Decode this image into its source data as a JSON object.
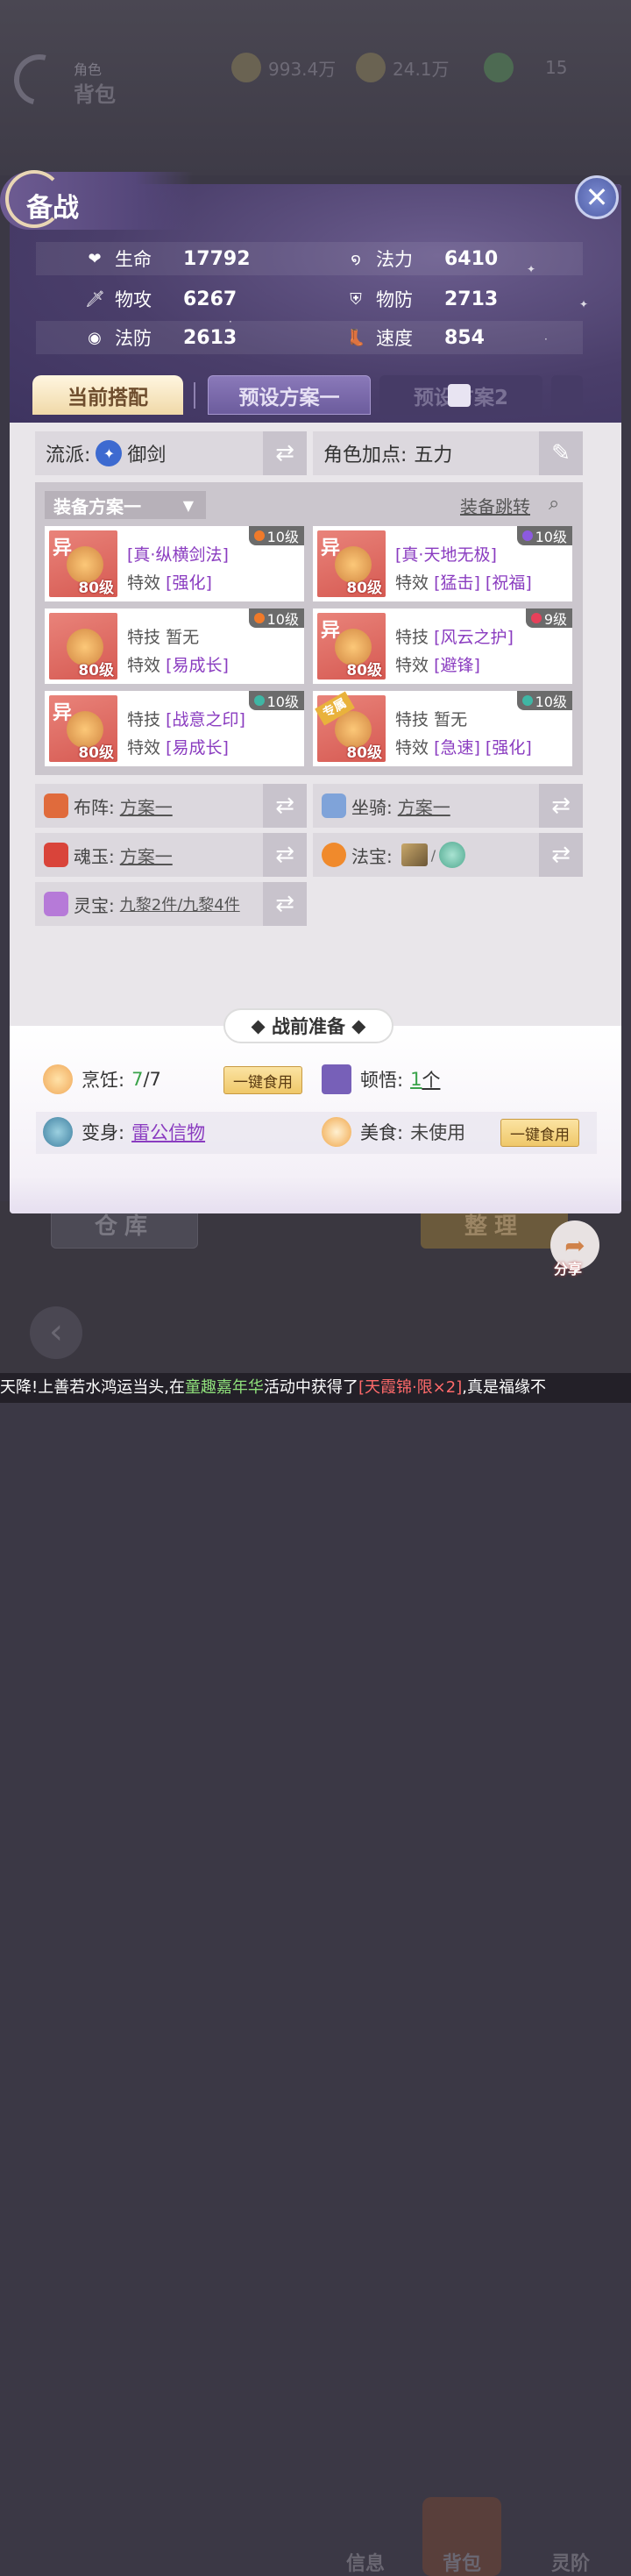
{
  "background": {
    "bag_subtitle": "角色",
    "bag_title": "背包",
    "currencies": [
      {
        "icon": "copper-coin-icon",
        "value": "993.4万"
      },
      {
        "icon": "gold-ingot-icon",
        "value": "24.1万"
      },
      {
        "icon": "jade-icon",
        "value": "15"
      }
    ],
    "warehouse_label": "仓库",
    "sort_label": "整理",
    "share_label": "分享",
    "nav": [
      "信息",
      "背包",
      "灵阶"
    ]
  },
  "panel": {
    "title": "备战",
    "stats": [
      {
        "icon": "heart-icon",
        "label": "生命",
        "value": "17792"
      },
      {
        "icon": "swirl-icon",
        "label": "法力",
        "value": "6410"
      },
      {
        "icon": "sword-icon",
        "label": "物攻",
        "value": "6267"
      },
      {
        "icon": "shield-icon",
        "label": "物防",
        "value": "2713"
      },
      {
        "icon": "magic-shield-icon",
        "label": "法防",
        "value": "2613"
      },
      {
        "icon": "boot-icon",
        "label": "速度",
        "value": "854"
      }
    ],
    "tabs": {
      "current": "当前搭配",
      "preset1": "预设方案一",
      "preset2": "预设方案2"
    },
    "school": {
      "label": "流派:",
      "value": "御剑"
    },
    "points": {
      "label": "角色加点:",
      "value": "五力"
    },
    "equip": {
      "plan": "装备方案一",
      "jump": "装备跳转",
      "items": [
        {
          "mark": "异",
          "level": "80级",
          "badge": "10级",
          "badge_color": "#f07a2a",
          "line1": "[真·纵横剑法]",
          "line2_label": "特效",
          "line2": "[强化]"
        },
        {
          "mark": "异",
          "level": "80级",
          "badge": "10级",
          "badge_color": "#8c5ae0",
          "line1": "[真·天地无极]",
          "line2_label": "特效",
          "line2": "[猛击] [祝福]"
        },
        {
          "mark": "",
          "level": "80级",
          "badge": "10级",
          "badge_color": "#f07a2a",
          "line1_label": "特技",
          "line1": "暂无",
          "line2_label": "特效",
          "line2": "[易成长]"
        },
        {
          "mark": "异",
          "level": "80级",
          "badge": "9级",
          "badge_color": "#e6405a",
          "line1_label": "特技",
          "line1": "[风云之护]",
          "line2_label": "特效",
          "line2": "[避锋]"
        },
        {
          "mark": "异",
          "level": "80级",
          "badge": "10级",
          "badge_color": "#3fb6a4",
          "line1_label": "特技",
          "line1": "[战意之印]",
          "line2_label": "特效",
          "line2": "[易成长]"
        },
        {
          "mark": "专属",
          "level": "80级",
          "badge": "10级",
          "badge_color": "#3fb6a4",
          "line1_label": "特技",
          "line1": "暂无",
          "line2_label": "特效",
          "line2": "[急速] [强化]"
        }
      ]
    },
    "formation": {
      "label": "布阵:",
      "value": "方案一"
    },
    "mount": {
      "label": "坐骑:",
      "value": "方案一"
    },
    "soul_jade": {
      "label": "魂玉:",
      "value": "方案一"
    },
    "treasure": {
      "label": "法宝:",
      "sep": "/"
    },
    "spirit": {
      "label": "灵宝:",
      "value": "九黎2件/九黎4件"
    },
    "prep": {
      "title": "战前准备",
      "cooking": {
        "label": "烹饪:",
        "value": "7",
        "total": "/7",
        "btn": "一键食用"
      },
      "insight": {
        "label": "顿悟:",
        "value": "1",
        "unit": "个"
      },
      "transform": {
        "label": "变身:",
        "value": "雷公信物"
      },
      "food": {
        "label": "美食:",
        "value": "未使用",
        "btn": "一键食用"
      }
    }
  },
  "ticker": {
    "t1": "天降!上善若水鸿运当头,在",
    "t2": "童趣嘉年华",
    "t3": "活动中获得了",
    "t4": "[天霞锦·限×2]",
    "t5": ",真是福缘不"
  }
}
